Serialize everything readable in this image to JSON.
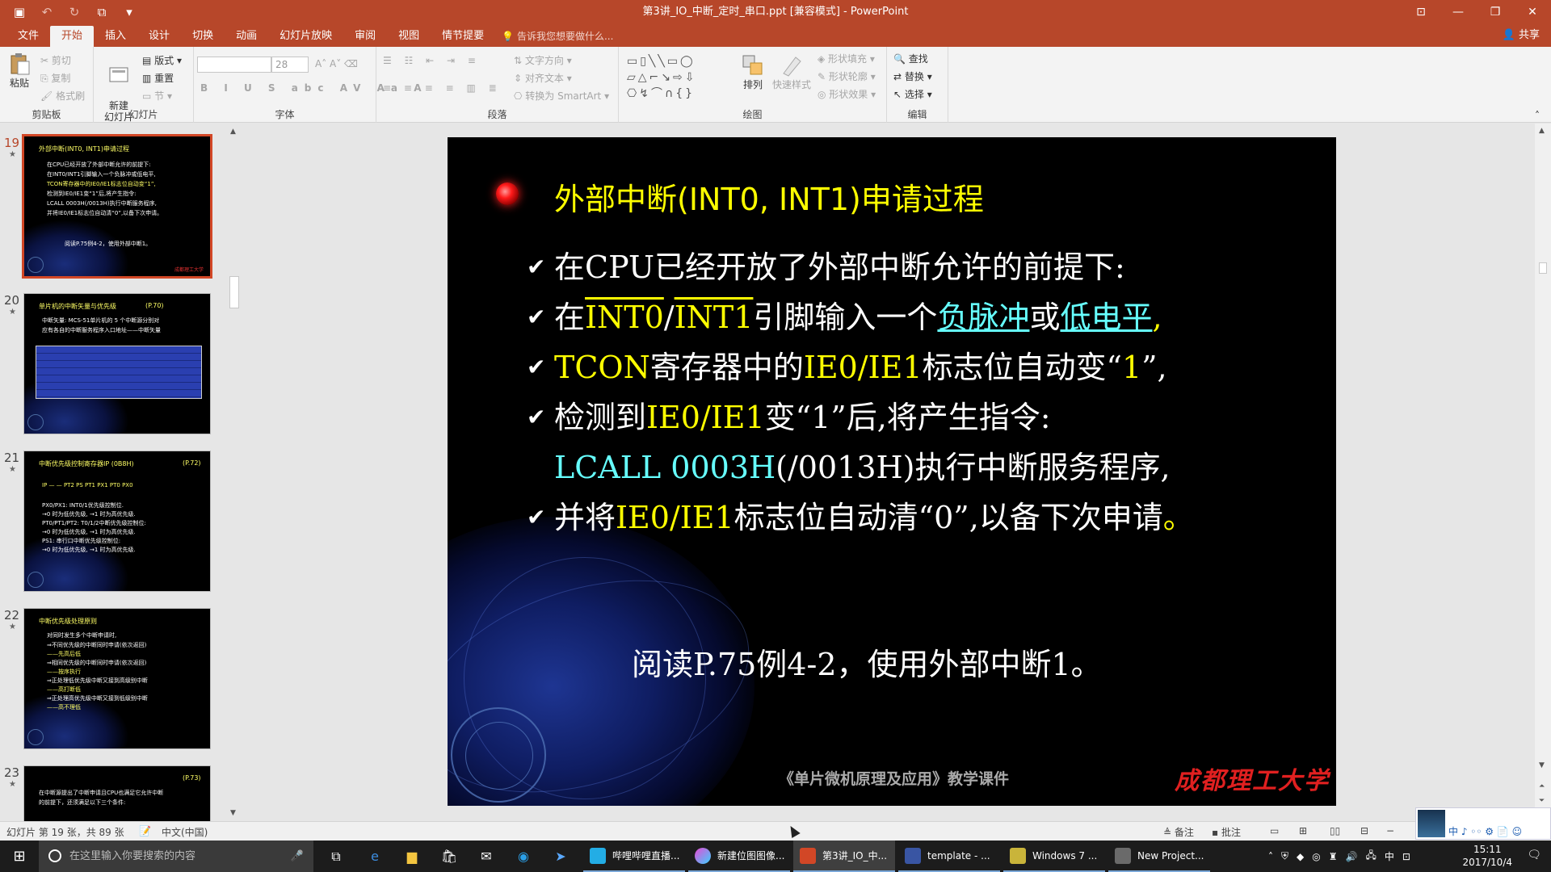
{
  "window": {
    "title": "第3讲_IO_中断_定时_串口.ppt [兼容模式] - PowerPoint",
    "accent": "#b7472a"
  },
  "ribbon_tabs": [
    "文件",
    "开始",
    "插入",
    "设计",
    "切换",
    "动画",
    "幻灯片放映",
    "审阅",
    "视图",
    "情节提要"
  ],
  "active_tab": "开始",
  "tell_me": "告诉我您想要做什么...",
  "share": "共享",
  "ribbon": {
    "clipboard": {
      "paste": "粘贴",
      "cut": "剪切",
      "copy": "复制",
      "format_painter": "格式刷",
      "label": "剪贴板"
    },
    "slides": {
      "new_slide": "新建\n幻灯片",
      "layout": "版式",
      "reset": "重置",
      "section": "节",
      "label": "幻灯片"
    },
    "font": {
      "size": "28",
      "label": "字体"
    },
    "paragraph": {
      "text_direction": "文字方向",
      "align_text": "对齐文本",
      "smartart": "转换为 SmartArt",
      "label": "段落"
    },
    "drawing": {
      "arrange": "排列",
      "quick_styles": "快速样式",
      "shape_fill": "形状填充",
      "shape_outline": "形状轮廓",
      "shape_effects": "形状效果",
      "label": "绘图"
    },
    "editing": {
      "find": "查找",
      "replace": "替换",
      "select": "选择",
      "label": "编辑"
    }
  },
  "thumbnails": [
    {
      "num": "19",
      "title": "外部中断(INT0, INT1)申请过程",
      "lines": [
        "在CPU已经开放了外部中断允许的前提下:",
        "在INT0/INT1引脚输入一个负脉冲或低电平,",
        "TCON寄存器中的IE0/IE1标志位自动变“1”,",
        "检测到IE0/IE1变“1”后,将产生指令:",
        "LCALL 0003H(/0013H)执行中断服务程序,",
        "并将IE0/IE1标志位自动清“0”,以备下次申请。",
        "阅读P.75例4-2，使用外部中断1。"
      ]
    },
    {
      "num": "20",
      "title": "单片机的中断矢量与优先级",
      "ref": "(P.70)",
      "lines": [
        "中断矢量:  MCS-51单片机的 5 个中断源分别对",
        "应有各自的中断服务程序入口地址——中断矢量"
      ]
    },
    {
      "num": "21",
      "title": "中断优先级控制寄存器IP   (0B8H)",
      "ref": "(P.72)",
      "lines": [
        "IP  — — PT2 PS PT1 PX1 PT0 PX0",
        "PX0/PX1:  INT0/1优先级控制位.",
        "   →0 时为低优先级,  →1 时为高优先级.",
        "PT0/PT1/PT2:  T0/1/2中断优先级控制位:",
        "   →0 时为低优先级,  →1 时为高优先级.",
        "PS1:  串行口中断优先级控制位:",
        "   →0 时为低优先级,  →1 时为高优先级."
      ]
    },
    {
      "num": "22",
      "title": "中断优先级处理原则",
      "lines": [
        "对同时发生多个中断申请时,",
        "⇒不同优先级的中断同时申请(依次返回)",
        "      ——先高后低",
        "⇒相同优先级的中断同时申请(依次返回)",
        "      ——按序执行",
        "⇒正处理低优先级中断又接到高级别中断",
        "      ——高打断低",
        "⇒正处理高优先级中断又接到低级别中断",
        "      ——高不理低"
      ]
    },
    {
      "num": "23",
      "ref": "(P.73)",
      "lines": [
        "在中断源提出了中断申请且CPU也满足它允许中断",
        "的前提下，还须满足以下三个条件:"
      ]
    }
  ],
  "slide": {
    "title": "外部中断(INT0, INT1)申请过程",
    "bullets": {
      "b1": "在CPU已经开放了外部中断允许的前提下:",
      "b2_a": "在",
      "b2_b": "INT0",
      "b2_c": "/",
      "b2_d": "INT1",
      "b2_e": "引脚输入一个",
      "b2_f": "负脉冲",
      "b2_g": "或",
      "b2_h": "低电平",
      "b2_i": ",",
      "b3_a": "TCON",
      "b3_b": "寄存器中的",
      "b3_c": "IE0/IE1",
      "b3_d": "标志位自动变“",
      "b3_e": "1",
      "b3_f": "”,",
      "b4_a": "检测到",
      "b4_b": "IE0/IE1",
      "b4_c": "变“1”后,将产生指令:",
      "b5_a": "LCALL 0003H",
      "b5_b": "(/0013H)执行中断服务程序,",
      "b6_a": "并将",
      "b6_b": "IE0/IE1",
      "b6_c": "标志位自动清“0”,以备下次申请",
      "b6_d": "。"
    },
    "read": "阅读P.75例4-2，使用外部中断1。",
    "footer_book": "《单片微机原理及应用》教学课件",
    "footer_uni": "成都理工大学"
  },
  "statusbar": {
    "slide_info": "幻灯片 第 19 张，共 89 张",
    "language": "中文(中国)",
    "notes": "备注",
    "comments": "批注"
  },
  "taskbar": {
    "search_placeholder": "在这里输入你要搜索的内容",
    "apps": [
      "哔哩哔哩直播...",
      "新建位图图像...",
      "第3讲_IO_中...",
      "template - ...",
      "Windows 7 ...",
      "New Project..."
    ],
    "tray_lang": "中",
    "time": "15:11",
    "date": "2017/10/4"
  },
  "ime": {
    "text": "中 ♪ ◦◦ ⚙ 📄 ☺"
  }
}
